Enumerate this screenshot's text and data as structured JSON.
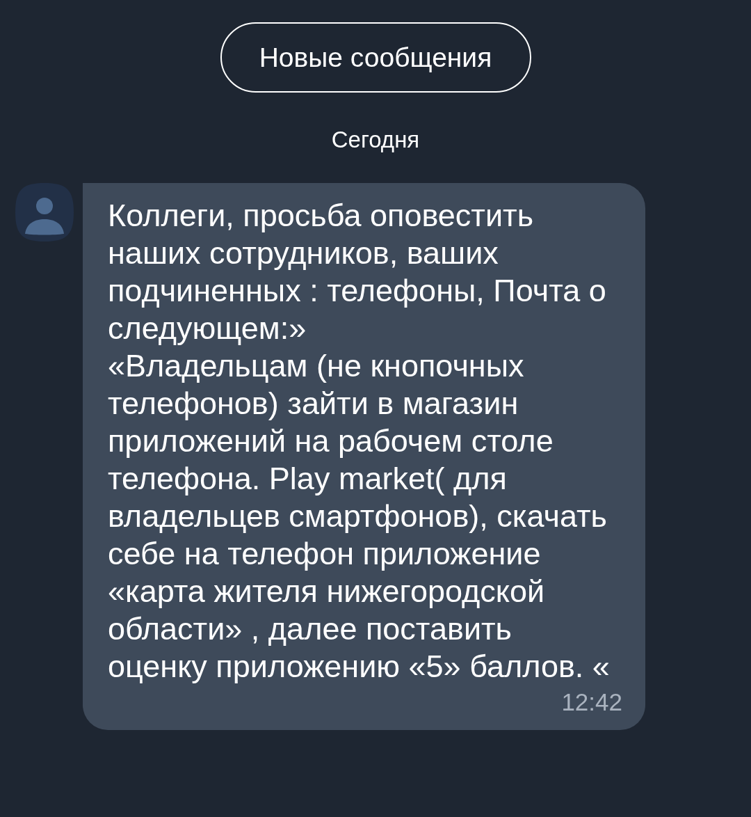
{
  "new_messages_button": {
    "label": "Новые сообщения"
  },
  "date_divider": "Сегодня",
  "messages": [
    {
      "text": "Коллеги, просьба оповестить наших сотрудников, ваших подчиненных : телефоны, Почта о следующем:»\n«Владельцам (не кнопочных телефонов) зайти в магазин приложений на рабочем столе телефона. Play market( для владельцев смартфонов), скачать себе на телефон приложение «карта жителя нижегородской области» , далее поставить оценку приложению «5» баллов. «",
      "time": "12:42"
    }
  ]
}
